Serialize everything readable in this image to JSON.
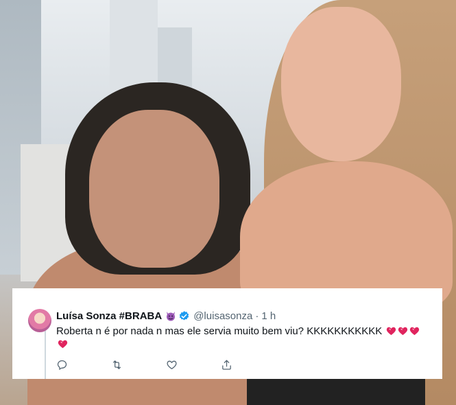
{
  "tweet": {
    "display_name": "Luísa Sonza #BRABA",
    "handle": "@luisasonza",
    "separator": "·",
    "time": "1 h",
    "text": "Roberta n é por nada n mas ele servia muito bem viu? KKKKKKKKKKK",
    "verified": true,
    "icons": [
      "devil-emoji",
      "verified-badge-icon",
      "heart-emoji",
      "reply-icon",
      "retweet-icon",
      "like-icon",
      "share-icon"
    ]
  },
  "colors": {
    "text_primary": "#0f1419",
    "text_secondary": "#536471",
    "verified_blue": "#1d9bf0",
    "card_background": "#ffffff"
  }
}
